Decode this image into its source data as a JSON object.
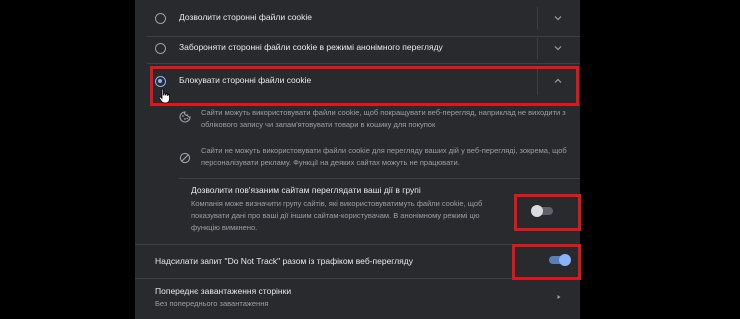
{
  "options": [
    {
      "label": "Дозволити сторонні файли cookie",
      "selected": false,
      "expanded": false
    },
    {
      "label": "Забороняти сторонні файли cookie в режимі анонімного перегляду",
      "selected": false,
      "expanded": false
    },
    {
      "label": "Блокувати сторонні файли cookie",
      "selected": true,
      "expanded": true
    }
  ],
  "details": [
    {
      "icon": "cookie-icon",
      "text": "Сайти можуть використовувати файли cookie, щоб покращувати веб-перегляд, наприклад не виходити з облікового запису чи запам'ятовувати товари в кошику для покупок"
    },
    {
      "icon": "block-icon",
      "text": "Сайти не можуть використовувати файли cookie для перегляду ваших дій у веб-перегляді, зокрема, щоб персоналізувати рекламу. Функції на деяких сайтах можуть не працювати."
    }
  ],
  "related_sites": {
    "title": "Дозволити пов'язаним сайтам переглядати ваші дії в групі",
    "description": "Компанія може визначити групу сайтів, які використовуватимуть файли cookie, щоб показувати дані про ваші дії іншим сайтам-користувачам. В анонімному режимі цю функцію вимкнено.",
    "enabled": false
  },
  "do_not_track": {
    "label": "Надсилати запит \"Do Not Track\" разом із трафіком веб-перегляду",
    "enabled": true
  },
  "preload": {
    "title": "Попереднє завантаження сторінки",
    "subtitle": "Без попереднього завантаження"
  },
  "colors": {
    "panel_bg": "#292a2d",
    "accent": "#8ab4f8",
    "highlight": "#e0161b"
  }
}
